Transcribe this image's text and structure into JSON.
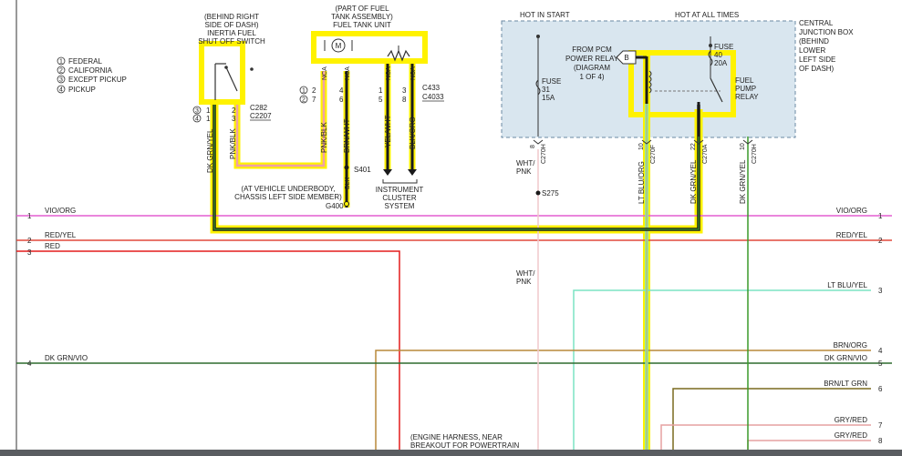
{
  "colors": {
    "highlight": "#fff200",
    "highlight_box": "#ffef6b",
    "wire_dark": "#1a1a1a",
    "vio_org": "#e45fd0",
    "red_yel": "#e0493c",
    "red": "#e31b1b",
    "lt_blu": "#7ce3c4",
    "lt_blu_org": "#6fe8d6",
    "brn_org": "#b8883a",
    "dk_grn_vio": "#2e6b2e",
    "brn_lt_grn": "#7a6a1e",
    "gry_red": "#e6a0a0",
    "wht_pnk": "#f0c8cc",
    "pnk_blk": "#f0a0a8",
    "dk_grn_yel": "#3a9a2a",
    "junction_box": "#d9e6ef"
  },
  "legend": {
    "items": [
      "FEDERAL",
      "CALIFORNIA",
      "EXCEPT PICKUP",
      "PICKUP"
    ],
    "nums": [
      "1",
      "2",
      "3",
      "4"
    ]
  },
  "inertia": {
    "lines": [
      "(BEHIND RIGHT",
      "SIDE OF DASH)",
      "INERTIA FUEL",
      "SHUT OFF SWITCH"
    ],
    "pins_left": [
      "1",
      "1"
    ],
    "pins_left_cond": [
      "3",
      "4"
    ],
    "pins_right": [
      "2",
      "3"
    ],
    "connectors": [
      "C282",
      "C2207"
    ],
    "wire_left": "DK GRN/YEL",
    "wire_right": "PNK/BLK"
  },
  "fuel_tank": {
    "lines": [
      "(PART OF FUEL",
      "TANK ASSEMBLY)",
      "FUEL TANK UNIT"
    ],
    "motor": "M",
    "nca": [
      "NCA",
      "NCA",
      "NCA",
      "NCA"
    ],
    "pins_a": [
      "2",
      "4",
      "1",
      "3"
    ],
    "pins_b": [
      "7",
      "6",
      "5",
      "8"
    ],
    "cond_a": "1",
    "cond_b": "2",
    "connectors": [
      "C433",
      "C4033"
    ],
    "wires": [
      "PNK/BLK",
      "BRN/WHT",
      "YEL/WHT",
      "BLK/ORG"
    ]
  },
  "ground": {
    "splice": "S401",
    "wire": "BLK",
    "lines": [
      "(AT VEHICLE UNDERBODY,",
      "CHASSIS LEFT SIDE MEMBER)"
    ],
    "ground_id": "G400"
  },
  "cluster": {
    "lines": [
      "INSTRUMENT",
      "CLUSTER",
      "SYSTEM"
    ]
  },
  "junction": {
    "hot_in_start": "HOT IN START",
    "hot_at_all_times": "HOT AT ALL TIMES",
    "title_lines": [
      "CENTRAL",
      "JUNCTION BOX",
      "(BEHIND",
      "LOWER",
      "LEFT SIDE",
      "OF DASH)"
    ],
    "fuse31": [
      "FUSE",
      "31",
      "15A"
    ],
    "fuse40": [
      "FUSE",
      "40",
      "20A"
    ],
    "pcm_lines": [
      "FROM PCM",
      "POWER RELAY",
      "(DIAGRAM",
      "1 OF 4)"
    ],
    "pcm_marker": "B",
    "relay_lines": [
      "FUEL",
      "PUMP",
      "RELAY"
    ]
  },
  "connector_pins": [
    {
      "pin": "8",
      "conn": "C270H"
    },
    {
      "pin": "10",
      "conn": "C270F"
    },
    {
      "pin": "22",
      "conn": "C270A"
    },
    {
      "pin": "10",
      "conn": "C270H"
    }
  ],
  "center_wires": {
    "wht_pnk_top": [
      "WHT/",
      "PNK"
    ],
    "s275": "S275",
    "wht_pnk_mid": [
      "WHT/",
      "PNK"
    ],
    "lt_blu_org": "LT BLU/ORG",
    "dk_grn_yel_a": "DK GRN/YEL",
    "dk_grn_yel_b": "DK GRN/YEL"
  },
  "circuits_left": [
    {
      "num": "1",
      "label": "VIO/ORG"
    },
    {
      "num": "2",
      "label": "RED/YEL"
    },
    {
      "num": "3",
      "label": "RED"
    },
    {
      "num": "4",
      "label": "DK GRN/VIO"
    }
  ],
  "circuits_right": [
    {
      "num": "1",
      "label": "VIO/ORG"
    },
    {
      "num": "2",
      "label": "RED/YEL"
    },
    {
      "num": "3",
      "label": "LT BLU/YEL"
    },
    {
      "num": "4",
      "label": "BRN/ORG"
    },
    {
      "num": "5",
      "label": "DK GRN/VIO"
    },
    {
      "num": "6",
      "label": "BRN/LT GRN"
    },
    {
      "num": "7",
      "label": "GRY/RED"
    },
    {
      "num": "8",
      "label": "GRY/RED"
    }
  ],
  "harness": [
    "(ENGINE HARNESS, NEAR",
    "BREAKOUT FOR POWERTRAIN"
  ]
}
